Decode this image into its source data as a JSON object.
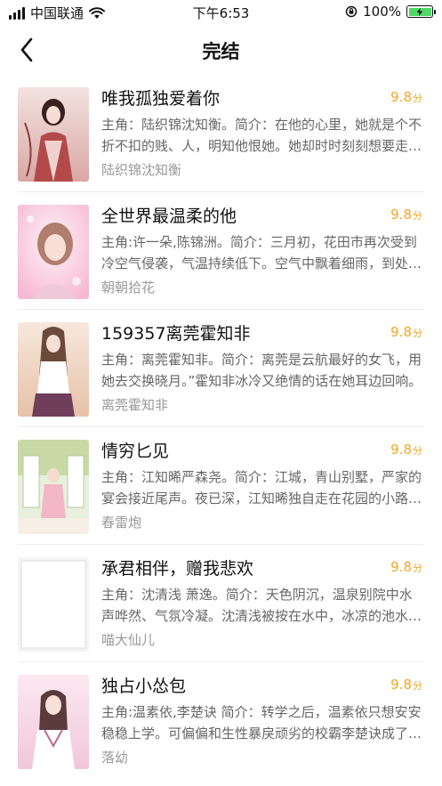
{
  "status_bar": {
    "carrier": "中国联通",
    "time": "下午6:53",
    "battery": "100%"
  },
  "nav": {
    "title": "完结"
  },
  "books": [
    {
      "title": "唯我孤独爱着你",
      "score": "9.8",
      "score_unit": "分",
      "description": "主角：陆织锦沈知衡。简介：在他的心里，她就是个不折不扣的贱、人，明知他恨她。她却时时刻刻想要走进他的心，她以为只要时间到了，他就会接受她。",
      "author": "陆织锦沈知衡",
      "cover_colors": [
        "#f3e3e0",
        "#d9a7a3",
        "#8a3b3b"
      ]
    },
    {
      "title": "全世界最温柔的他",
      "score": "9.8",
      "score_unit": "分",
      "description": "主角:许一朵,陈锦洲。简介：三月初，花田市再次受到冷空气侵袭，气温持续低下。空气中飘着细雨，到处都是湿哒哒的。",
      "author": "朝朝拾花",
      "cover_colors": [
        "#fde6f0",
        "#f6b8d2",
        "#c98fa6"
      ]
    },
    {
      "title": "159357离莞霍知非",
      "score": "9.8",
      "score_unit": "分",
      "description": "主角：离莞霍知非。简介：离莞是云航最好的女飞，用她去交换晓月。”霍知非冰冷又绝情的话在她耳边回响。",
      "author": "离莞霍知非",
      "cover_colors": [
        "#f7e8dc",
        "#e6c1a8",
        "#6f3e5a"
      ]
    },
    {
      "title": "情穷匕见",
      "score": "9.8",
      "score_unit": "分",
      "description": "主角：江知晞严森尧。简介：江城，青山别墅，严家的宴会接近尾声。夜已深，江知晞独自走在花园的小路上。",
      "author": "春雷炮",
      "cover_colors": [
        "#e7f0dc",
        "#c8d9a5",
        "#c0392b"
      ]
    },
    {
      "title": "承君相伴，赠我悲欢",
      "score": "9.8",
      "score_unit": "分",
      "description": "主角：沈清浅 萧逸。简介：天色阴沉，温泉别院中水声哗然、气氛冷凝。沈清浅被按在水中，冰凉的池水漫过了她的口鼻。",
      "author": "喵大仙儿",
      "cover_colors": [
        "#ffffff",
        "#f2f2f2",
        "#dddddd"
      ]
    },
    {
      "title": "独占小怂包",
      "score": "9.8",
      "score_unit": "分",
      "description": "主角:温素依,李楚诀 简介：转学之后，温素依只想安安稳稳上学。可偏偏和生性暴戾顽劣的校霸李楚诀成了同桌。",
      "author": "落幼",
      "cover_colors": [
        "#fbe9f1",
        "#f2c6da",
        "#b86b8c"
      ]
    }
  ]
}
